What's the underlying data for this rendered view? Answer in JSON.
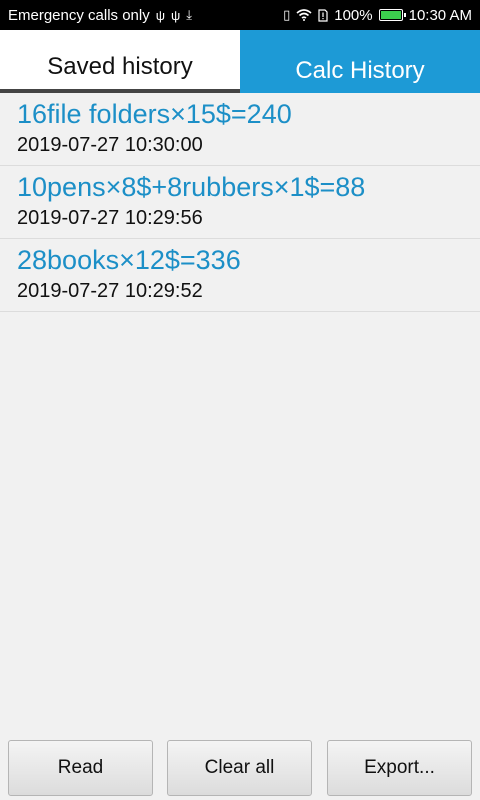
{
  "status_bar": {
    "carrier": "Emergency calls only",
    "battery": "100%",
    "time": "10:30 AM",
    "icons": [
      "usb-icon",
      "usb-icon",
      "download-icon",
      "vibrate-icon",
      "wifi-icon",
      "sim-icon",
      "battery-icon"
    ]
  },
  "tabs": [
    {
      "label": "Saved history",
      "selected": true
    },
    {
      "label": "Calc History",
      "selected": false
    }
  ],
  "history": [
    {
      "expression": "16file folders×15$=240",
      "timestamp": "2019-07-27 10:30:00"
    },
    {
      "expression": "10pens×8$+8rubbers×1$=88",
      "timestamp": "2019-07-27 10:29:56"
    },
    {
      "expression": "28books×12$=336",
      "timestamp": "2019-07-27 10:29:52"
    }
  ],
  "buttons": {
    "read": "Read",
    "clear_all": "Clear all",
    "export": "Export..."
  },
  "colors": {
    "accent": "#1d9ad6",
    "expression_text": "#1c8fc7"
  }
}
